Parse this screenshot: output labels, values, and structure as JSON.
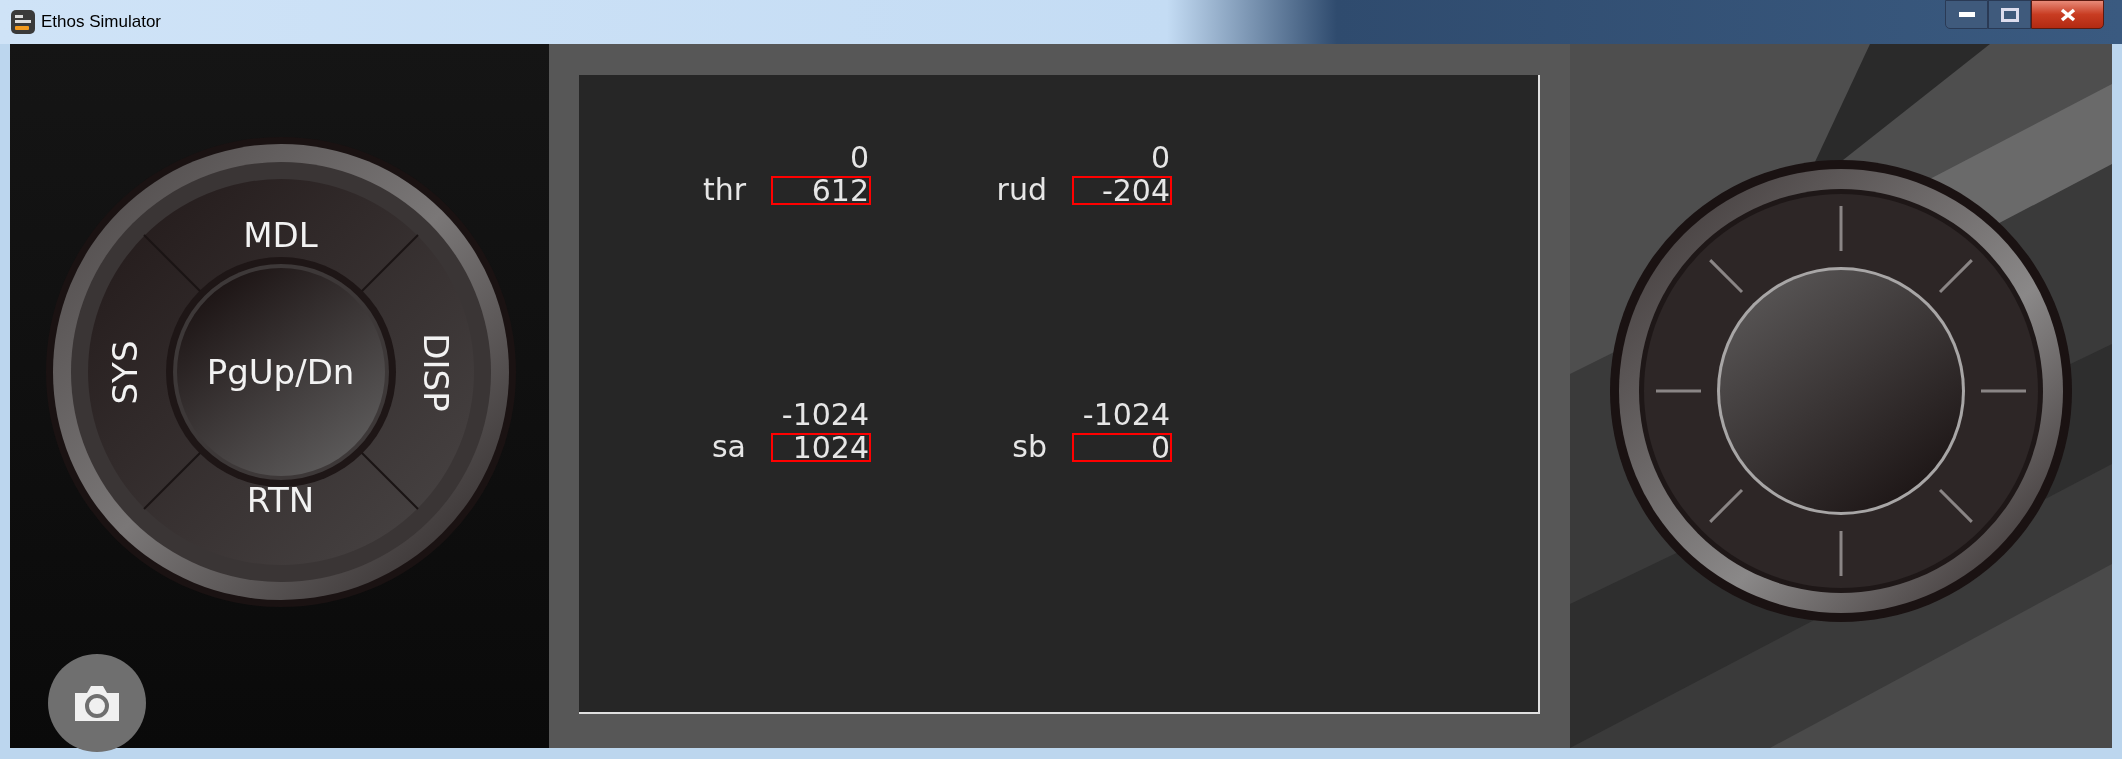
{
  "window": {
    "title": "Ethos Simulator"
  },
  "keys": [
    {
      "label": "MDL",
      "kind": "top"
    },
    {
      "label": "SYS",
      "kind": "left"
    },
    {
      "label": "PgUp/Dn",
      "kind": "center"
    },
    {
      "label": "DISP",
      "kind": "right"
    },
    {
      "label": "RTN",
      "kind": "bottom"
    }
  ],
  "channels": [
    {
      "label": "thr",
      "output": "0",
      "value": "612"
    },
    {
      "label": "rud",
      "output": "0",
      "value": "-204"
    },
    {
      "label": "sa",
      "output": "-1024",
      "value": "1024"
    },
    {
      "label": "sb",
      "output": "-1024",
      "value": "0"
    }
  ]
}
